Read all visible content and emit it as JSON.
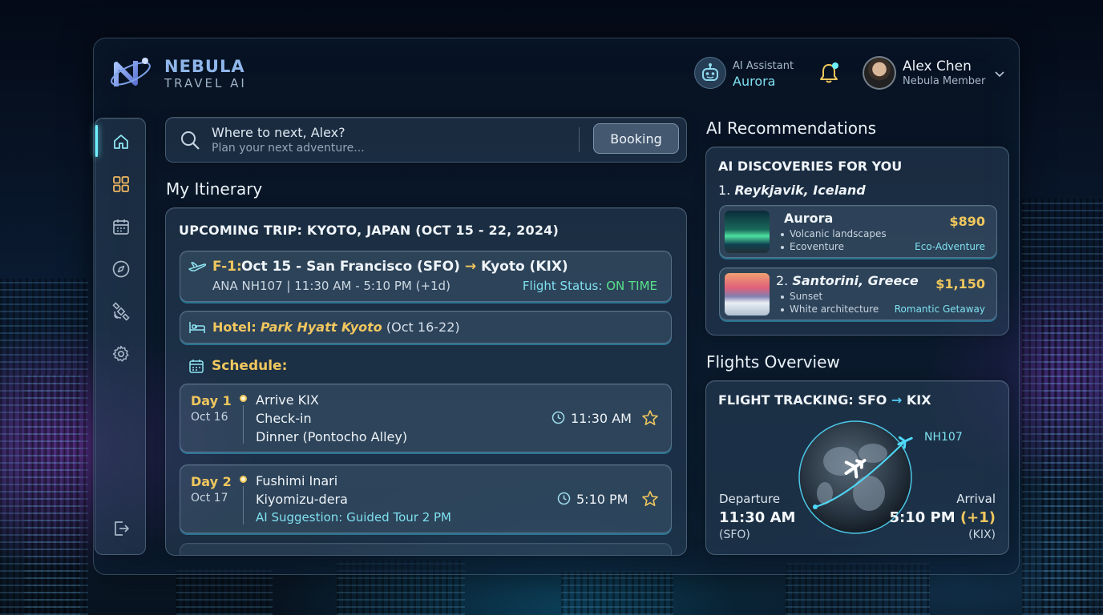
{
  "app": {
    "brand_main": "NEBULA",
    "brand_sub": "TRAVEL AI"
  },
  "header": {
    "assistant_label": "AI Assistant",
    "assistant_name": "Aurora",
    "user_name": "Alex Chen",
    "user_role": "Nebula Member"
  },
  "sidebar": {
    "items": [
      {
        "name": "home",
        "icon": "home-icon"
      },
      {
        "name": "dashboard",
        "icon": "grid-icon"
      },
      {
        "name": "calendar",
        "icon": "calendar-icon"
      },
      {
        "name": "explore",
        "icon": "compass-icon"
      },
      {
        "name": "satellite",
        "icon": "satellite-icon"
      },
      {
        "name": "settings",
        "icon": "gear-icon"
      }
    ],
    "logout": {
      "name": "logout",
      "icon": "logout-icon"
    }
  },
  "search": {
    "title": "Where to next, Alex?",
    "subtitle": "Plan your next adventure...",
    "button": "Booking"
  },
  "itinerary": {
    "section_title": "My Itinerary",
    "trip_title": "UPCOMING TRIP: KYOTO, JAPAN (OCT 15 - 22, 2024)",
    "flight": {
      "code": "F-1:",
      "route_a": "Oct 15 - San Francisco (SFO)",
      "arrow": "→",
      "route_b": "Kyoto (KIX)",
      "details": "ANA NH107 | 11:30 AM - 5:10 PM (+1d)",
      "status_label": "Flight Status:",
      "status_value": "ON TIME"
    },
    "hotel": {
      "label": "Hotel:",
      "name": "Park Hyatt Kyoto",
      "dates": "(Oct 16-22)"
    },
    "schedule_label": "Schedule:",
    "days": [
      {
        "day": "Day 1",
        "date": "Oct 16",
        "items": [
          "Arrive KIX",
          "Check-in",
          "Dinner (Pontocho Alley)"
        ],
        "time": "11:30 AM"
      },
      {
        "day": "Day 2",
        "date": "Oct 17",
        "items": [
          "Fushimi Inari",
          "Kiyomizu-dera"
        ],
        "suggestion": "AI Suggestion: Guided Tour 2 PM",
        "time": "5:10 PM"
      }
    ]
  },
  "recommendations": {
    "section_title": "AI Recommendations",
    "card_title": "AI DISCOVERIES FOR YOU",
    "first_heading_num": "1.",
    "first_heading_place": "Reykjavik, Iceland",
    "items": [
      {
        "title": "Aurora",
        "bullets": [
          "Volcanic landscapes",
          "Ecoventure"
        ],
        "price": "$890",
        "tag": "Eco-Adventure"
      },
      {
        "num": "2.",
        "title": "Santorini, Greece",
        "bullets": [
          "Sunset",
          "White architecture"
        ],
        "price": "$1,150",
        "tag": "Romantic Getaway"
      }
    ]
  },
  "flights": {
    "section_title": "Flights Overview",
    "tracking_label": "FLIGHT TRACKING: SFO",
    "tracking_arrow": "→",
    "tracking_dest": "KIX",
    "flight_no": "NH107",
    "departure_label": "Departure",
    "departure_time": "11:30 AM",
    "departure_code": "(SFO)",
    "arrival_label": "Arrival",
    "arrival_time": "5:10 PM",
    "arrival_offset": "(+1)",
    "arrival_code": "(KIX)"
  },
  "colors": {
    "accent": "#7fe0f0",
    "gold": "#f0c75e",
    "status_green": "#58e08a"
  }
}
